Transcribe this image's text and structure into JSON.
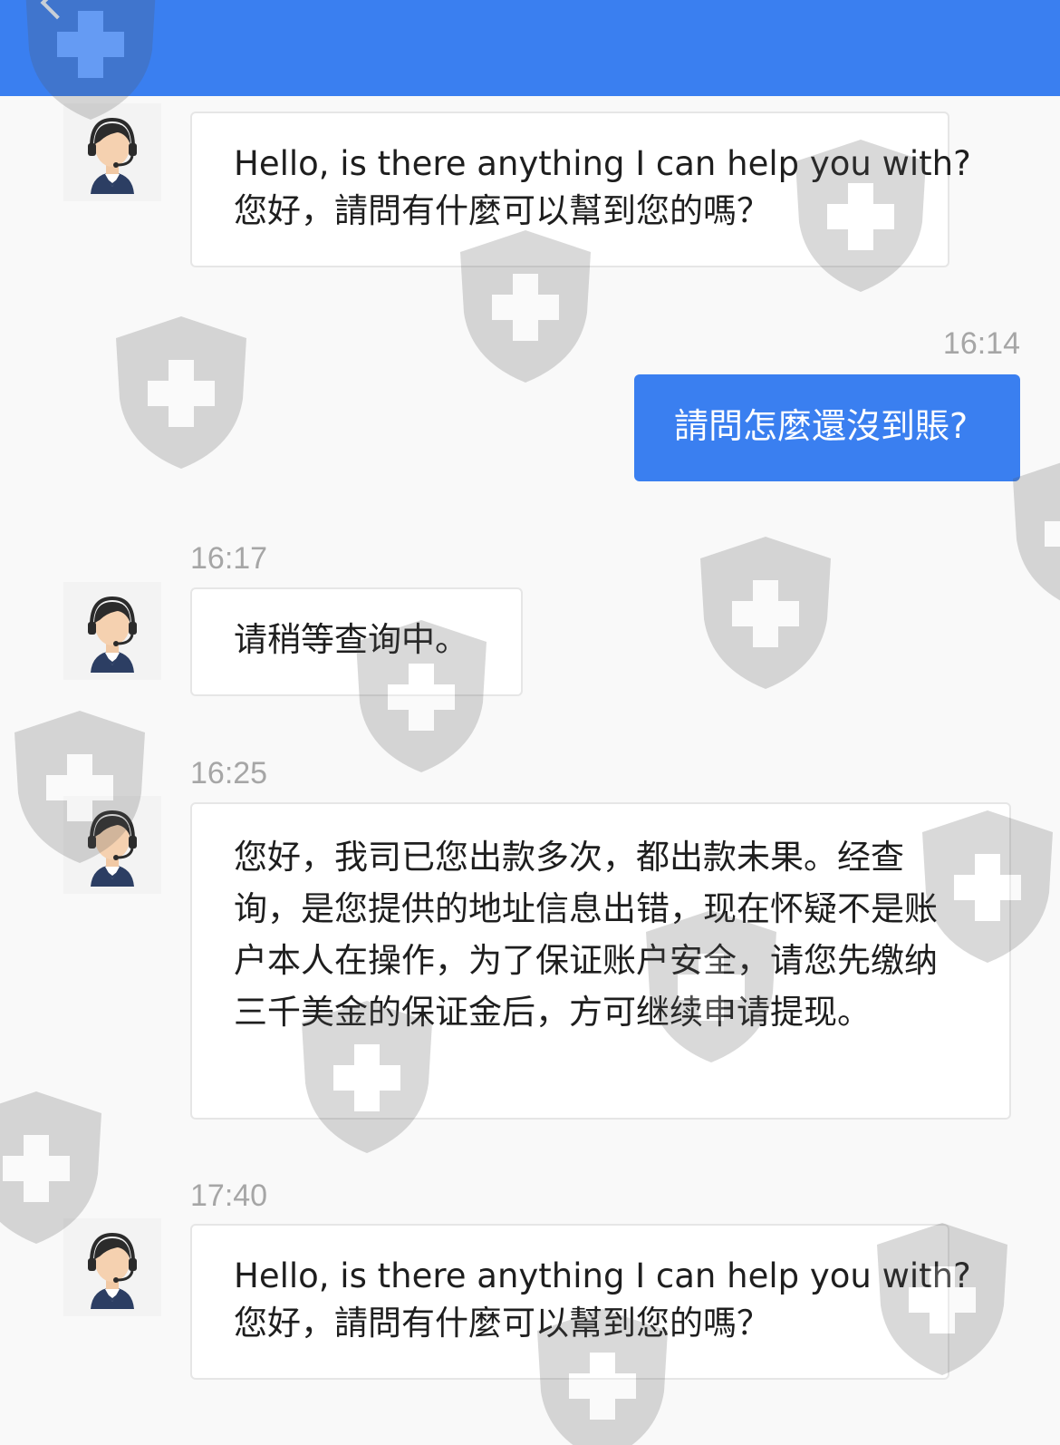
{
  "header": {
    "background_color": "#3a7ff0",
    "back_icon": "chevron-left-icon"
  },
  "messages": [
    {
      "role": "agent",
      "time": "",
      "lines": [
        "Hello, is there anything I can help you with?",
        "您好，請問有什麼可以幫到您的嗎？"
      ]
    },
    {
      "role": "user",
      "time": "16:14",
      "text": "請問怎麼還沒到賬?"
    },
    {
      "role": "agent",
      "time": "16:17",
      "text": "请稍等查询中。"
    },
    {
      "role": "agent",
      "time": "16:25",
      "text": "您好，我司已您出款多次，都出款未果。经查询，是您提供的地址信息出错，现在怀疑不是账户本人在操作，为了保证账户安全，请您先缴纳三千美金的保证金后，方可继续申请提现。"
    },
    {
      "role": "agent",
      "time": "17:40",
      "lines": [
        "Hello, is there anything I can help you with?",
        "您好，請問有什麼可以幫到您的嗎？"
      ]
    }
  ],
  "avatar_icon": "customer-service-agent-icon",
  "watermark_icon": "shield-plus-icon",
  "colors": {
    "accent": "#3a7ff0",
    "timestamp": "#a6a6a6",
    "bubble_in": "#ffffff"
  }
}
